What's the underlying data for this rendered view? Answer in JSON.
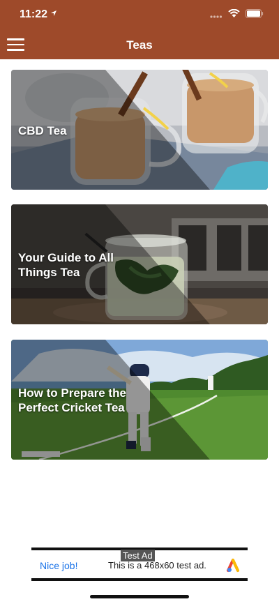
{
  "status_bar": {
    "time": "11:22"
  },
  "header": {
    "title": "Teas"
  },
  "cards": [
    {
      "title": "CBD Tea"
    },
    {
      "title": "Your Guide to All Things Tea"
    },
    {
      "title": "How to Prepare the Perfect Cricket Tea"
    }
  ],
  "ad": {
    "label": "Test Ad",
    "nice_text": "Nice job!",
    "body_text": "This is a 468x60 test ad."
  },
  "colors": {
    "header": "#9e4a2a",
    "link": "#1a73e8"
  }
}
